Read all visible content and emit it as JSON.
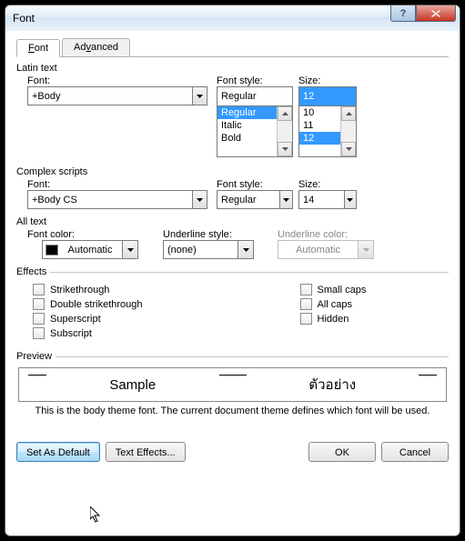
{
  "window": {
    "title": "Font"
  },
  "tabs": {
    "font": "Font",
    "advanced": "Advanced"
  },
  "latin": {
    "group": "Latin text",
    "font_label": "Font:",
    "font_value": "+Body",
    "style_label": "Font style:",
    "style_value": "Regular",
    "style_list": [
      "Regular",
      "Italic",
      "Bold"
    ],
    "size_label": "Size:",
    "size_value": "12",
    "size_list": [
      "10",
      "11",
      "12"
    ]
  },
  "complex": {
    "group": "Complex scripts",
    "font_label": "Font:",
    "font_value": "+Body CS",
    "style_label": "Font style:",
    "style_value": "Regular",
    "size_label": "Size:",
    "size_value": "14"
  },
  "alltext": {
    "group": "All text",
    "color_label": "Font color:",
    "color_value": "Automatic",
    "underline_label": "Underline style:",
    "underline_value": "(none)",
    "ucolor_label": "Underline color:",
    "ucolor_value": "Automatic"
  },
  "effects": {
    "group": "Effects",
    "strike": "Strikethrough",
    "dstrike": "Double strikethrough",
    "super": "Superscript",
    "sub": "Subscript",
    "smallcaps": "Small caps",
    "allcaps": "All caps",
    "hidden": "Hidden"
  },
  "preview": {
    "group": "Preview",
    "sample1": "Sample",
    "sample2": "ตัวอย่าง",
    "desc": "This is the body theme font. The current document theme defines which font will be used."
  },
  "buttons": {
    "default": "Set As Default",
    "effects": "Text Effects...",
    "ok": "OK",
    "cancel": "Cancel"
  }
}
